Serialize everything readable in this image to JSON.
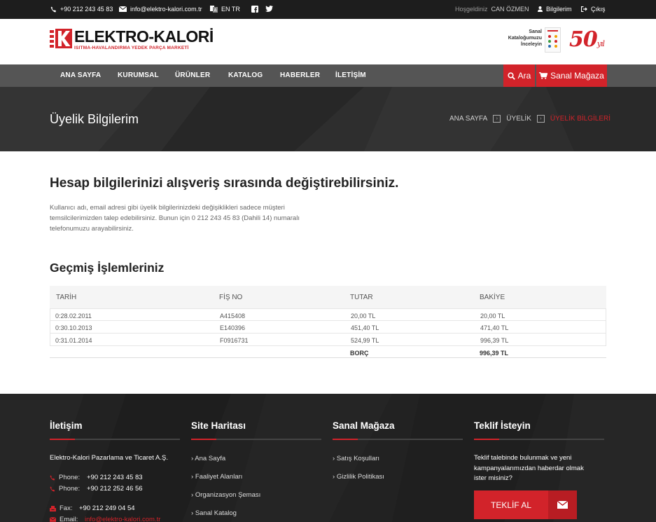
{
  "topbar": {
    "phone": "+90 212 243 45 83",
    "email": "info@elektro-kalori.com.tr",
    "languages": "EN TR",
    "welcome_prefix": "Hoşgeldiniz",
    "user_name": "CAN ÖZMEN",
    "account_link": "Bilgilerim",
    "logout_link": "Çıkış"
  },
  "header": {
    "logo_name": "ELEKTRO-KALORİ",
    "logo_tagline": "ISITMA-HAVALANDIRMA YEDEK PARÇA MARKETİ",
    "catalog_promo": [
      "Sanal",
      "Kataloğumuzu",
      "İnceleyin"
    ],
    "anniversary_number": "50",
    "anniversary_suffix": "yıl"
  },
  "nav": {
    "items": [
      "ANA SAYFA",
      "KURUMSAL",
      "ÜRÜNLER",
      "KATALOG",
      "HABERLER",
      "İLETİŞİM"
    ],
    "search_label": "Ara",
    "store_label": "Sanal Mağaza"
  },
  "banner": {
    "title": "Üyelik Bilgilerim",
    "breadcrumb": [
      "ANA SAYFA",
      "ÜYELİK",
      "ÜYELİK BİLGİLERİ"
    ]
  },
  "info": {
    "heading": "Hesap bilgilerinizi alışveriş sırasında değiştirebilirsiniz.",
    "paragraph": "Kullanıcı adı, email adresi gibi üyelik bilgilerinizdeki değişiklikleri sadece müşteri temsilcilerimizden talep edebilirsiniz. Bunun için 0 212 243 45 83 (Dahili 14) numaralı telefonumuzu arayabilirsiniz."
  },
  "history": {
    "heading": "Geçmiş İşlemleriniz",
    "columns": [
      "TARİH",
      "FİŞ NO",
      "TUTAR",
      "BAKİYE"
    ],
    "rows": [
      [
        "0:28.02.2011",
        "A415408",
        "20,00 TL",
        "20,00 TL"
      ],
      [
        "0:30.10.2013",
        "E140396",
        "451,40 TL",
        "471,40 TL"
      ],
      [
        "0:31.01.2014",
        "F0916731",
        "524,99 TL",
        "996,39 TL"
      ]
    ],
    "total_label": "BORÇ",
    "total_value": "996,39 TL"
  },
  "footer": {
    "contact": {
      "heading": "İletişim",
      "company": "Elektro-Kalori Pazarlama ve Ticaret A.Ş.",
      "phone_label": "Phone:",
      "phone1": "+90 212 243 45 83",
      "phone2": "+90 212 252 46 56",
      "fax_label": "Fax:",
      "fax": "+90 212 249 04 54",
      "email_label": "Email:",
      "email": "info@elektro-kalori.com.tr"
    },
    "sitemap": {
      "heading": "Site Haritası",
      "links": [
        "Ana Sayfa",
        "Faaliyet Alanları",
        "Organizasyon Şeması",
        "Sanal Katalog"
      ]
    },
    "store": {
      "heading": "Sanal Mağaza",
      "links": [
        "Satış Koşulları",
        "Gizlilik Politikası"
      ]
    },
    "quote": {
      "heading": "Teklif İsteyin",
      "text": [
        "Teklif talebinde bulunmak ve yeni",
        "kampanyalarımızdan haberdar olmak",
        "ister misiniz?"
      ],
      "button_label": "TEKLİF AL"
    }
  },
  "colors": {
    "accent": "#d2232a",
    "topbar": "#1d1d1d",
    "nav": "#555555",
    "footer": "#222222"
  }
}
